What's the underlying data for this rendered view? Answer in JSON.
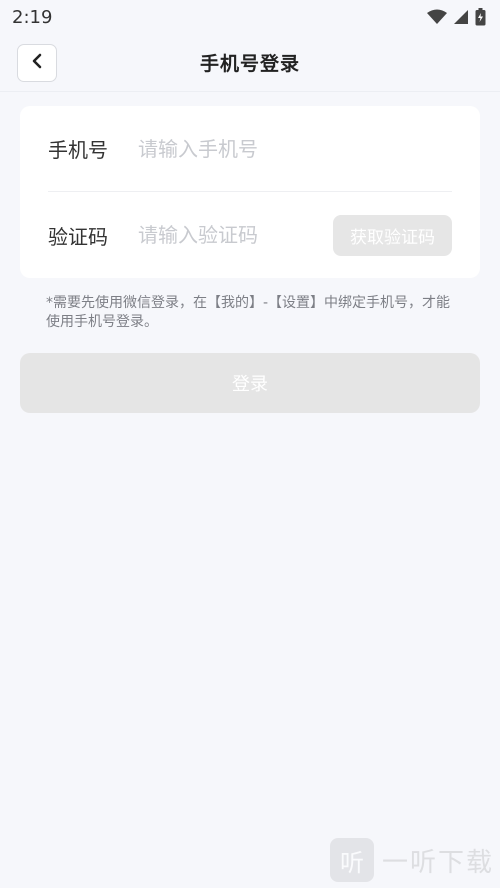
{
  "status_bar": {
    "time": "2:19",
    "icons": [
      "wifi-icon",
      "cellular-signal-icon",
      "battery-icon"
    ]
  },
  "header": {
    "title": "手机号登录",
    "back_icon": "chevron-left-icon"
  },
  "form": {
    "phone": {
      "label": "手机号",
      "placeholder": "请输入手机号",
      "value": ""
    },
    "code": {
      "label": "验证码",
      "placeholder": "请输入验证码",
      "value": "",
      "get_code_label": "获取验证码"
    }
  },
  "notice": "*需要先使用微信登录，在【我的】-【设置】中绑定手机号，才能使用手机号登录。",
  "login_button_label": "登录",
  "watermark": {
    "text": "一听下载",
    "logo_char": "听"
  },
  "colors": {
    "background": "#f6f7fb",
    "card": "#ffffff",
    "disabled_button": "#e5e5e5",
    "placeholder": "#c8cacf"
  }
}
